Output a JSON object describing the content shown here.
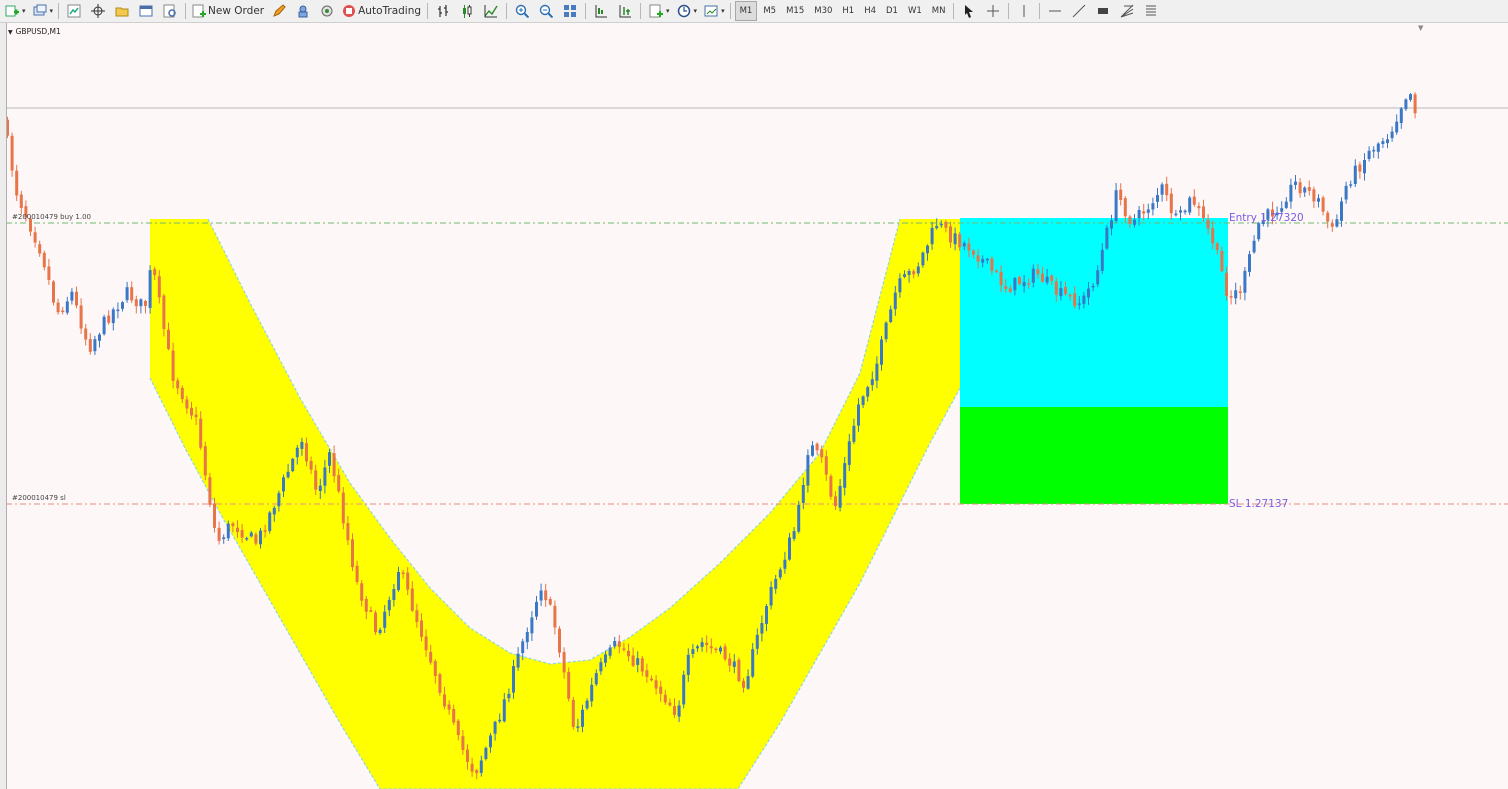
{
  "toolbar": {
    "new_order": "New Order",
    "auto_trading": "AutoTrading",
    "timeframes": [
      "M1",
      "M5",
      "M15",
      "M30",
      "H1",
      "H4",
      "D1",
      "W1",
      "MN"
    ],
    "active_timeframe": "M1"
  },
  "chart": {
    "symbol": "GBPUSD,M1",
    "entry_line_label": "#200010479 buy 1.00",
    "sl_line_label": "#200010479 sl",
    "entry_price_label": "Entry 1.27320",
    "sl_price_label": "SL 1.27137",
    "colors": {
      "background": "#fdf7f7",
      "bull_candle": "#3a78c6",
      "bear_candle": "#e8744a",
      "channel_fill": "#ffff00",
      "channel_edge": "#8ed6e0",
      "profit_zone": "#00ffff",
      "loss_zone": "#00ff00",
      "entry_line": "#6fba6f",
      "sl_line": "#e88f86",
      "label_color": "#7b5de0"
    }
  }
}
